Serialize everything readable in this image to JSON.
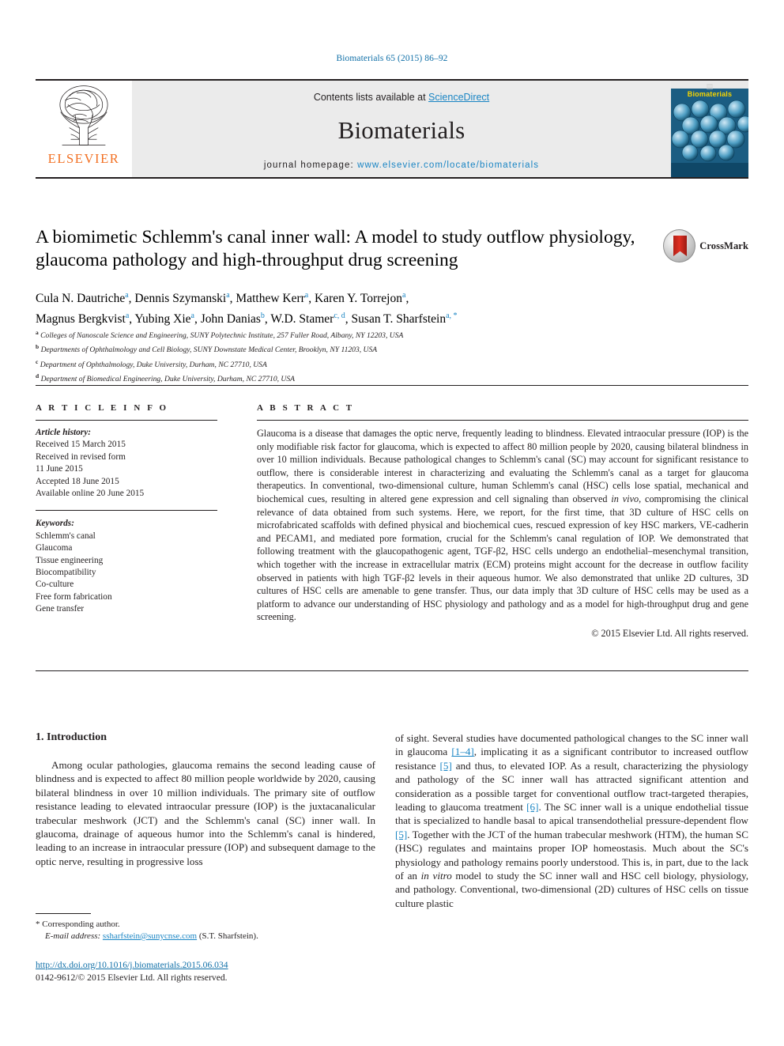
{
  "running_head": "Biomaterials 65 (2015) 86–92",
  "masthead": {
    "contents_prefix": "Contents lists available at ",
    "contents_link": "ScienceDirect",
    "journal_name": "Biomaterials",
    "homepage_prefix": "journal homepage:",
    "homepage_url": "www.elsevier.com/locate/biomaterials",
    "publisher_name": "ELSEVIER",
    "cover_title": "Biomaterials",
    "cover_top_glyph": "▤"
  },
  "article": {
    "title": "A biomimetic Schlemm's canal inner wall: A model to study outflow physiology, glaucoma pathology and high-throughput drug screening",
    "crossmark_label": "CrossMark",
    "authors_line_1": "Cula N. Dautriche ᵃ, Dennis Szymanski ᵃ, Matthew Kerr ᵃ, Karen Y. Torrejon ᵃ,",
    "authors_line_2": "Magnus Bergkvist ᵃ, Yubing Xie ᵃ, John Danias ᵇ, W.D. Stamer ᶜ·ᵈ, Susan T. Sharfstein ᵃ·*",
    "authors": [
      {
        "name": "Cula N. Dautriche",
        "marks": "a"
      },
      {
        "name": "Dennis Szymanski",
        "marks": "a"
      },
      {
        "name": "Matthew Kerr",
        "marks": "a"
      },
      {
        "name": "Karen Y. Torrejon",
        "marks": "a"
      },
      {
        "name": "Magnus Bergkvist",
        "marks": "a"
      },
      {
        "name": "Yubing Xie",
        "marks": "a"
      },
      {
        "name": "John Danias",
        "marks": "b"
      },
      {
        "name": "W.D. Stamer",
        "marks": "c, d"
      },
      {
        "name": "Susan T. Sharfstein",
        "marks": "a, *"
      }
    ],
    "affiliations": [
      {
        "mark": "a",
        "text": "Colleges of Nanoscale Science and Engineering, SUNY Polytechnic Institute, 257 Fuller Road, Albany, NY 12203, USA"
      },
      {
        "mark": "b",
        "text": "Departments of Ophthalmology and Cell Biology, SUNY Downstate Medical Center, Brooklyn, NY 11203, USA"
      },
      {
        "mark": "c",
        "text": "Department of Ophthalmology, Duke University, Durham, NC 27710, USA"
      },
      {
        "mark": "d",
        "text": "Department of Biomedical Engineering, Duke University, Durham, NC 27710, USA"
      }
    ]
  },
  "article_info": {
    "heading": "A R T I C L E  I N F O",
    "history_label": "Article history:",
    "history": [
      "Received 15 March 2015",
      "Received in revised form",
      "11 June 2015",
      "Accepted 18 June 2015",
      "Available online 20 June 2015"
    ],
    "keywords_label": "Keywords:",
    "keywords": [
      "Schlemm's canal",
      "Glaucoma",
      "Tissue engineering",
      "Biocompatibility",
      "Co-culture",
      "Free form fabrication",
      "Gene transfer"
    ]
  },
  "abstract": {
    "heading": "A B S T R A C T",
    "paragraph_1": "Glaucoma is a disease that damages the optic nerve, frequently leading to blindness. Elevated intraocular pressure (IOP) is the only modifiable risk factor for glaucoma, which is expected to affect 80 million people by 2020, causing bilateral blindness in over 10 million individuals. Because pathological changes to Schlemm's canal (SC) may account for significant resistance to outflow, there is considerable interest in characterizing and evaluating the Schlemm's canal as a target for glaucoma therapeutics. In conventional, two-dimensional culture, human Schlemm's canal (HSC) cells lose spatial, mechanical and biochemical cues, resulting in altered gene expression and cell signaling than observed ",
    "italic_1": "in vivo",
    "paragraph_2": ", compromising the clinical relevance of data obtained from such systems. Here, we report, for the first time, that 3D culture of HSC cells on microfabricated scaffolds with defined physical and biochemical cues, rescued expression of key HSC markers, VE-cadherin and PECAM1, and mediated pore formation, crucial for the Schlemm's canal regulation of IOP. We demonstrated that following treatment with the glaucopathogenic agent, TGF-β2, HSC cells undergo an endothelial–mesenchymal transition, which together with the increase in extracellular matrix (ECM) proteins might account for the decrease in outflow facility observed in patients with high TGF-β2 levels in their aqueous humor. We also demonstrated that unlike 2D cultures, 3D cultures of HSC cells are amenable to gene transfer. Thus, our data imply that 3D culture of HSC cells may be used as a platform to advance our understanding of HSC physiology and pathology and as a model for high-throughput drug and gene screening.",
    "copyright": "© 2015 Elsevier Ltd. All rights reserved."
  },
  "introduction": {
    "heading": "1. Introduction",
    "left_paragraph": "Among ocular pathologies, glaucoma remains the second leading cause of blindness and is expected to affect 80 million people worldwide by 2020, causing bilateral blindness in over 10 million individuals. The primary site of outflow resistance leading to elevated intraocular pressure (IOP) is the juxtacanalicular trabecular meshwork (JCT) and the Schlemm's canal (SC) inner wall. In glaucoma, drainage of aqueous humor into the Schlemm's canal is hindered, leading to an increase in intraocular pressure (IOP) and subsequent damage to the optic nerve, resulting in progressive loss",
    "right_segments": [
      {
        "type": "text",
        "text": "of sight. Several studies have documented pathological changes to the SC inner wall in glaucoma "
      },
      {
        "type": "ref",
        "text": "[1–4]"
      },
      {
        "type": "text",
        "text": ", implicating it as a significant contributor to increased outflow resistance "
      },
      {
        "type": "ref",
        "text": "[5]"
      },
      {
        "type": "text",
        "text": " and thus, to elevated IOP. As a result, characterizing the physiology and pathology of the SC inner wall has attracted significant attention and consideration as a possible target for conventional outflow tract-targeted therapies, leading to glaucoma treatment "
      },
      {
        "type": "ref",
        "text": "[6]"
      },
      {
        "type": "text",
        "text": ". The SC inner wall is a unique endothelial tissue that is specialized to handle basal to apical transendothelial pressure-dependent flow "
      },
      {
        "type": "ref",
        "text": "[5]"
      },
      {
        "type": "text",
        "text": ". Together with the JCT of the human trabecular meshwork (HTM), the human SC (HSC) regulates and maintains proper IOP homeostasis. Much about the SC's physiology and pathology remains poorly understood. This is, in part, due to the lack of an "
      },
      {
        "type": "italic",
        "text": "in vitro"
      },
      {
        "type": "text",
        "text": " model to study the SC inner wall and HSC cell biology, physiology, and pathology. Conventional, two-dimensional (2D) cultures of HSC cells on tissue culture plastic"
      }
    ]
  },
  "footnote": {
    "corresponding_marker": "*",
    "corresponding_text": "Corresponding author.",
    "email_label": "E-mail address:",
    "email": "ssharfstein@sunycnse.com",
    "email_owner": "(S.T. Sharfstein)."
  },
  "footer": {
    "doi": "http://dx.doi.org/10.1016/j.biomaterials.2015.06.034",
    "issn_line": "0142-9612/© 2015 Elsevier Ltd. All rights reserved."
  }
}
